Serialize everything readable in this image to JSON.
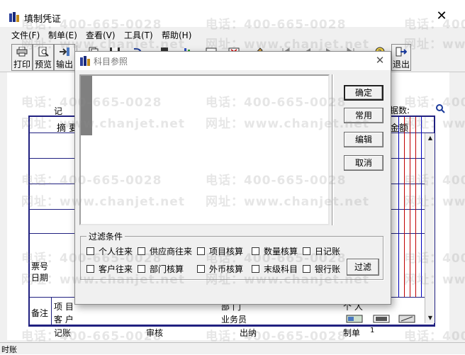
{
  "window": {
    "title": "填制凭证",
    "close_glyph": "✕"
  },
  "menu": [
    "文件(F)",
    "制单(E)",
    "查看(V)",
    "工具(T)",
    "帮助(H)"
  ],
  "toolbar": {
    "print": "打印",
    "preview": "预览",
    "output": "输出",
    "exit": "退出"
  },
  "voucher": {
    "type_label": "记",
    "docs_label": "据数:",
    "col_summary": "摘 要",
    "col_amount": "金额",
    "ticket_no": "票号",
    "date_label": "日期",
    "remarks": "备注",
    "project": "项  目",
    "customer": "客  户",
    "department": "部  门",
    "salesperson": "业务员",
    "person": "个  人",
    "bookkeeping": "记账",
    "review": "审核",
    "cashier": "出纳",
    "maker": "制单",
    "maker_value": "1"
  },
  "dialog": {
    "title": "科目参照",
    "close_glyph": "✕",
    "buttons": {
      "ok": "确定",
      "common": "常用",
      "edit": "编辑",
      "cancel": "取消"
    },
    "filter_title": "过滤条件",
    "filters_row1": [
      "个人往来",
      "供应商往来",
      "项目核算",
      "数量核算",
      "日记账"
    ],
    "filters_row2": [
      "客户往来",
      "部门核算",
      "外币核算",
      "末级科目",
      "银行账"
    ],
    "filter_button": "过滤"
  },
  "watermarks": {
    "phone": "电话：400-665-0028",
    "site": "网址：www.chanjet.net"
  },
  "statusbar": {
    "text": "时账"
  }
}
